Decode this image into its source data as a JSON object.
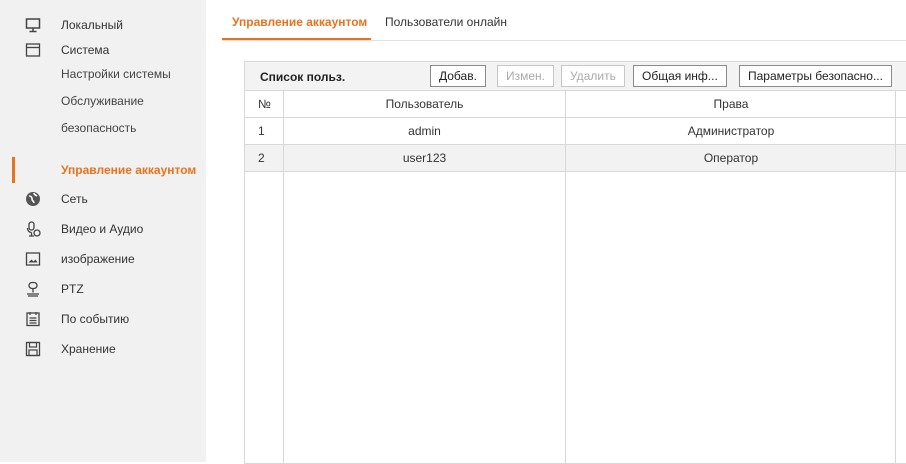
{
  "sidebar": {
    "items": [
      {
        "label": "Локальный",
        "icon": "monitor-icon"
      },
      {
        "label": "Система",
        "icon": "window-icon"
      },
      {
        "label": "Сеть",
        "icon": "globe-icon"
      },
      {
        "label": "Видео и Аудио",
        "icon": "microphone-icon"
      },
      {
        "label": "изображение",
        "icon": "image-icon"
      },
      {
        "label": "PTZ",
        "icon": "ptz-camera-icon"
      },
      {
        "label": "По событию",
        "icon": "event-list-icon"
      },
      {
        "label": "Хранение",
        "icon": "storage-disk-icon"
      }
    ],
    "system_sub": [
      {
        "label": "Настройки системы"
      },
      {
        "label": "Обслуживание"
      },
      {
        "label": "безопасность"
      },
      {
        "label": "Управление аккаунтом",
        "active": true
      }
    ]
  },
  "tabs": [
    {
      "label": "Управление аккаунтом",
      "active": true
    },
    {
      "label": "Пользователи онлайн",
      "active": false
    }
  ],
  "panel": {
    "title": "Список польз.",
    "buttons": {
      "add": "Добав.",
      "edit": "Измен.",
      "delete": "Удалить",
      "info": "Общая инф...",
      "security": "Параметры безопасно..."
    },
    "columns": [
      "№",
      "Пользователь",
      "Права"
    ],
    "rows": [
      {
        "no": "1",
        "user": "admin",
        "rights": "Администратор"
      },
      {
        "no": "2",
        "user": "user123",
        "rights": "Оператор"
      }
    ]
  },
  "colors": {
    "accent": "#e8731f",
    "sidebar_bg": "#f1f1f1"
  }
}
